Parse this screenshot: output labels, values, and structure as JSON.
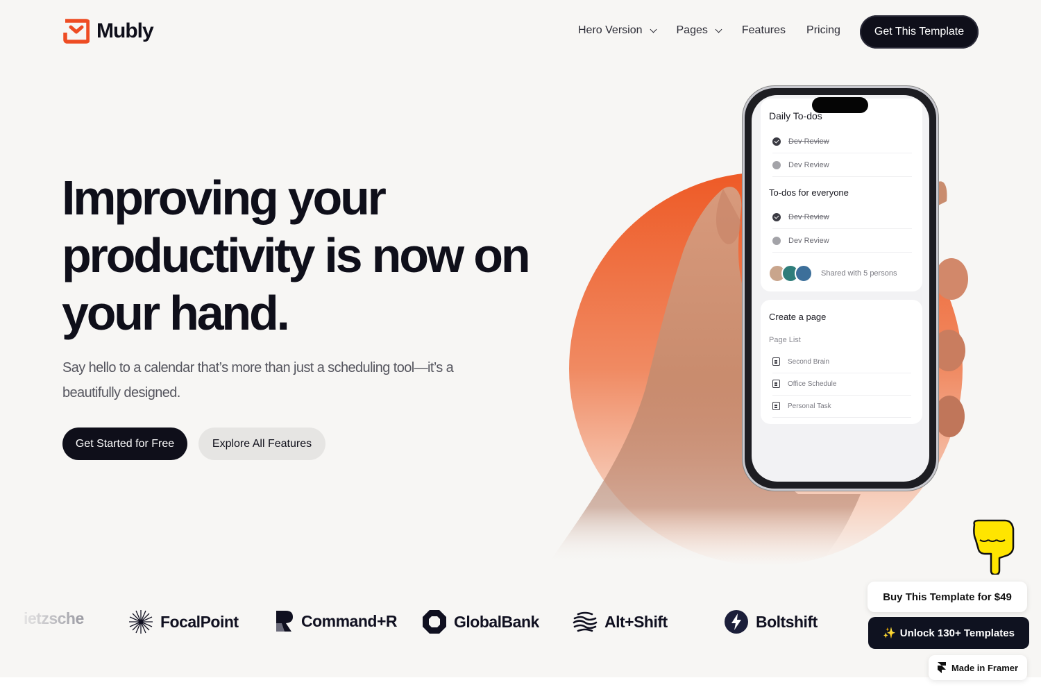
{
  "brand": {
    "name": "Mubly",
    "accent": "#ee4c23"
  },
  "nav": {
    "items": [
      {
        "label": "Hero Version",
        "dropdown": true
      },
      {
        "label": "Pages",
        "dropdown": true
      },
      {
        "label": "Features",
        "dropdown": false
      },
      {
        "label": "Pricing",
        "dropdown": false
      }
    ],
    "cta": "Get This Template"
  },
  "hero": {
    "title_lines": [
      "Improving your",
      "productivity is now on",
      "your hand."
    ],
    "subtitle": "Say hello to a calendar that’s more than just a scheduling tool—it’s a beautifully designed.",
    "primary_button": "Get Started for Free",
    "secondary_button": "Explore All Features"
  },
  "phone": {
    "daily_title": "Daily To-dos",
    "daily_items": [
      {
        "label": "Dev Review",
        "done": true
      },
      {
        "label": "Dev Review",
        "done": false
      }
    ],
    "everyone_title": "To-dos for everyone",
    "everyone_items": [
      {
        "label": "Dev Review",
        "done": true
      },
      {
        "label": "Dev Review",
        "done": false
      }
    ],
    "shared_text": "Shared with 5 persons",
    "create_title": "Create a page",
    "page_list_label": "Page List",
    "pages": [
      "Second Brain",
      "Office Schedule",
      "Personal Task"
    ]
  },
  "logos": [
    "ietzsche",
    "FocalPoint",
    "Command+R",
    "GlobalBank",
    "Alt+Shift",
    "Boltshift"
  ],
  "badges": {
    "buy": "Buy This Template for $49",
    "unlock_icon": "✨",
    "unlock": "Unlock 130+ Templates",
    "framer": "Made in Framer"
  }
}
